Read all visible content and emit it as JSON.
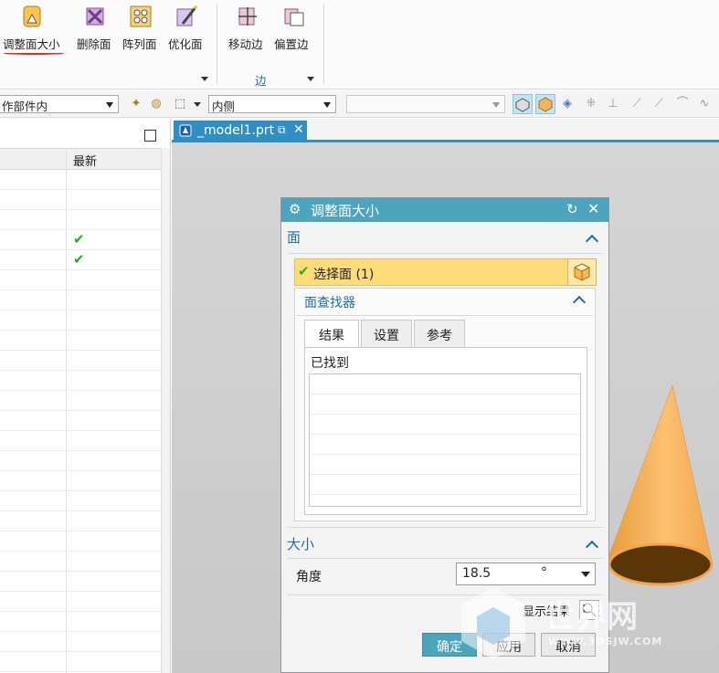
{
  "ribbon": {
    "buttons": [
      {
        "label": "调整面大小",
        "icon": "resize-face-icon"
      },
      {
        "label": "删除面",
        "icon": "delete-face-icon"
      },
      {
        "label": "阵列面",
        "icon": "pattern-face-icon"
      },
      {
        "label": "优化面",
        "icon": "optimize-face-icon"
      },
      {
        "label": "移动边",
        "icon": "move-edge-icon"
      },
      {
        "label": "偏置边",
        "icon": "offset-edge-icon"
      }
    ],
    "edge_group_label": "边"
  },
  "toolbar": {
    "scope_value": "作部件内",
    "side_value": "内侧",
    "empty_combo_value": ""
  },
  "left_panel": {
    "column_latest": "最新",
    "checked_rows": [
      4,
      5
    ]
  },
  "file_tab": {
    "name": "_model1.prt"
  },
  "dialog": {
    "title": "调整面大小",
    "face_section": "面",
    "select_face": "选择面 (1)",
    "face_finder": "面查找器",
    "tabs": [
      "结果",
      "设置",
      "参考"
    ],
    "found_label": "已找到",
    "size_section": "大小",
    "angle_label": "角度",
    "angle_value": "18.5",
    "angle_unit": "°",
    "show_result": "显示结果",
    "ok": "确定",
    "apply": "应用",
    "cancel": "取消"
  },
  "watermark": {
    "text": "世界网",
    "url": "WWW.3DSJW.COM"
  },
  "colors": {
    "accent": "#4aa5bd",
    "tab_blue": "#2e8fc4",
    "selection": "#ffdc7a",
    "cone": "#f8b557",
    "check": "#1fb31f"
  }
}
